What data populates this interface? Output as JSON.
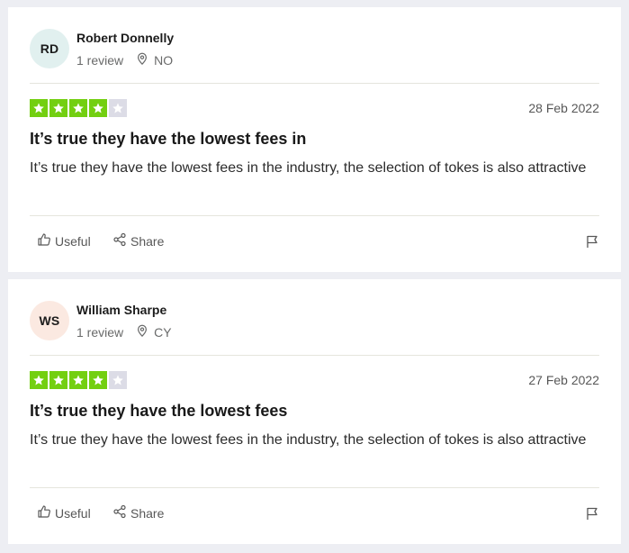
{
  "colors": {
    "star_filled": "#73cf11",
    "star_empty": "#dcdce6",
    "background": "#edeef3"
  },
  "reviews": [
    {
      "initials": "RD",
      "avatar_color": "#e1f0ef",
      "name": "Robert Donnelly",
      "review_count": "1 review",
      "country": "NO",
      "rating": 4,
      "date": "28 Feb 2022",
      "title": "It’s true they have the lowest fees in",
      "body": "It’s true they have the lowest fees in the industry, the selection of tokes is also attractive",
      "useful_label": "Useful",
      "share_label": "Share"
    },
    {
      "initials": "WS",
      "avatar_color": "#fbe9e1",
      "name": "William Sharpe",
      "review_count": "1 review",
      "country": "CY",
      "rating": 4,
      "date": "27 Feb 2022",
      "title": "It’s true they have the lowest fees",
      "body": "It’s true they have the lowest fees in the industry, the selection of tokes is also attractive",
      "useful_label": "Useful",
      "share_label": "Share"
    }
  ]
}
